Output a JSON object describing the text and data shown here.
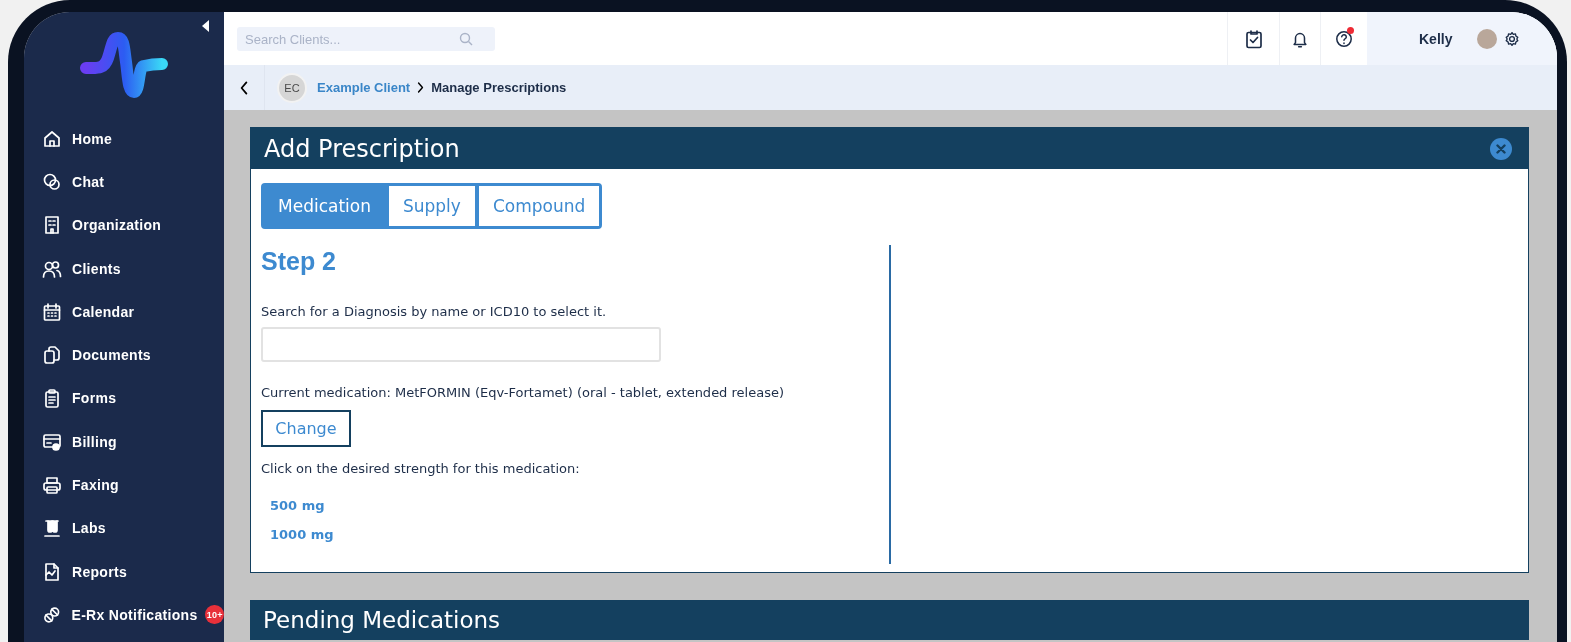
{
  "sidebar": {
    "items": [
      {
        "label": "Home"
      },
      {
        "label": "Chat"
      },
      {
        "label": "Organization"
      },
      {
        "label": "Clients"
      },
      {
        "label": "Calendar"
      },
      {
        "label": "Documents"
      },
      {
        "label": "Forms"
      },
      {
        "label": "Billing"
      },
      {
        "label": "Faxing"
      },
      {
        "label": "Labs"
      },
      {
        "label": "Reports"
      },
      {
        "label": "E-Rx Notifications",
        "badge": "10+"
      }
    ]
  },
  "topbar": {
    "search": {
      "placeholder": "Search Clients..."
    },
    "help_alert": true,
    "user": {
      "name": "Kelly"
    }
  },
  "breadcrumb": {
    "avatar_initials": "EC",
    "client": "Example Client",
    "current": "Manage Prescriptions"
  },
  "dialog": {
    "title": "Add Prescription",
    "tabs": [
      {
        "label": "Medication",
        "selected": true
      },
      {
        "label": "Supply",
        "selected": false
      },
      {
        "label": "Compound",
        "selected": false
      }
    ],
    "step": "Step 2",
    "diagnosis_label": "Search for a Diagnosis by name or ICD10 to select it.",
    "current_medication": "Current medication: MetFORMIN (Eqv-Fortamet) (oral - tablet, extended release)",
    "change_button": "Change",
    "strength_prompt": "Click on the desired strength for this medication:",
    "strengths": [
      "500 mg",
      "1000 mg"
    ]
  },
  "pending": {
    "title": "Pending Medications"
  }
}
